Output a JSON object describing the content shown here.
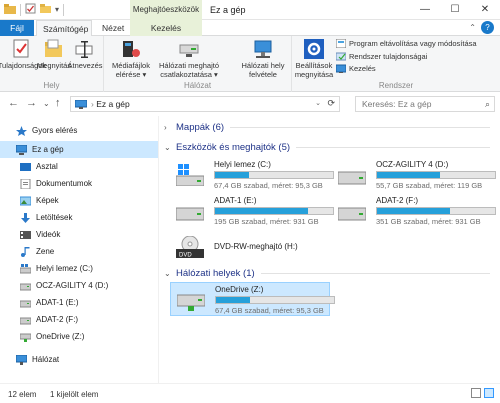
{
  "window": {
    "title": "Ez a gép",
    "context_tab_title": "Meghajtóeszközök",
    "controls": {
      "minimize": "—",
      "maximize": "☐",
      "close": "✕"
    }
  },
  "tabs": {
    "file": "Fájl",
    "computer": "Számítógép",
    "view": "Nézet",
    "manage": "Kezelés",
    "help": "?"
  },
  "ribbon": {
    "location": {
      "label": "Hely",
      "buttons": [
        "Tulajdonságok",
        "Megnyitás",
        "Átnevezés"
      ]
    },
    "network": {
      "label": "Hálózat",
      "buttons": [
        {
          "line1": "Médiafájlok",
          "line2": "elérése ▾"
        },
        {
          "line1": "Hálózati meghajtó",
          "line2": "csatlakoztatása ▾"
        },
        {
          "line1": "Hálózati hely",
          "line2": "felvétele"
        }
      ]
    },
    "system": {
      "label": "Rendszer",
      "big": {
        "line1": "Beállítások",
        "line2": "megnyitása"
      },
      "small": [
        "Program eltávolítása vagy módosítása",
        "Rendszer tulajdonságai",
        "Kezelés"
      ]
    }
  },
  "address": {
    "path": "Ez a gép",
    "search_placeholder": "Keresés: Ez a gép"
  },
  "nav": {
    "quick_access": "Gyors elérés",
    "this_pc": "Ez a gép",
    "items": [
      "Asztal",
      "Dokumentumok",
      "Képek",
      "Letöltések",
      "Videók",
      "Zene",
      "Helyi lemez (C:)",
      "OCZ-AGILITY 4 (D:)",
      "ADAT-1 (E:)",
      "ADAT-2 (F:)",
      "OneDrive (Z:)"
    ],
    "network": "Hálózat"
  },
  "sections": {
    "folders": "Mappák (6)",
    "devices": "Eszközök és meghajtók (5)",
    "network_locations": "Hálózati helyek (1)"
  },
  "drives": [
    {
      "name": "Helyi lemez (C:)",
      "info": "67,4 GB szabad, méret: 95,3 GB",
      "used_fraction": 0.29
    },
    {
      "name": "OCZ-AGILITY 4 (D:)",
      "info": "55,7 GB szabad, méret: 119 GB",
      "used_fraction": 0.53
    },
    {
      "name": "ADAT-1 (E:)",
      "info": "195 GB szabad, méret: 931 GB",
      "used_fraction": 0.79
    },
    {
      "name": "ADAT-2 (F:)",
      "info": "351 GB szabad, méret: 931 GB",
      "used_fraction": 0.62
    },
    {
      "name": "DVD-RW-meghajtó (H:)",
      "info": "",
      "used_fraction": null
    }
  ],
  "network_drives": [
    {
      "name": "OneDrive (Z:)",
      "info": "67,4 GB szabad, méret: 95,3 GB",
      "used_fraction": 0.29
    }
  ],
  "status": {
    "count": "12 elem",
    "selected": "1 kijelölt elem"
  },
  "colors": {
    "accent": "#1979ca",
    "selection": "#cce8ff",
    "bar_fill": "#26a0da",
    "section_heading": "#1e3287",
    "context_tab": "#e8f1d9"
  }
}
